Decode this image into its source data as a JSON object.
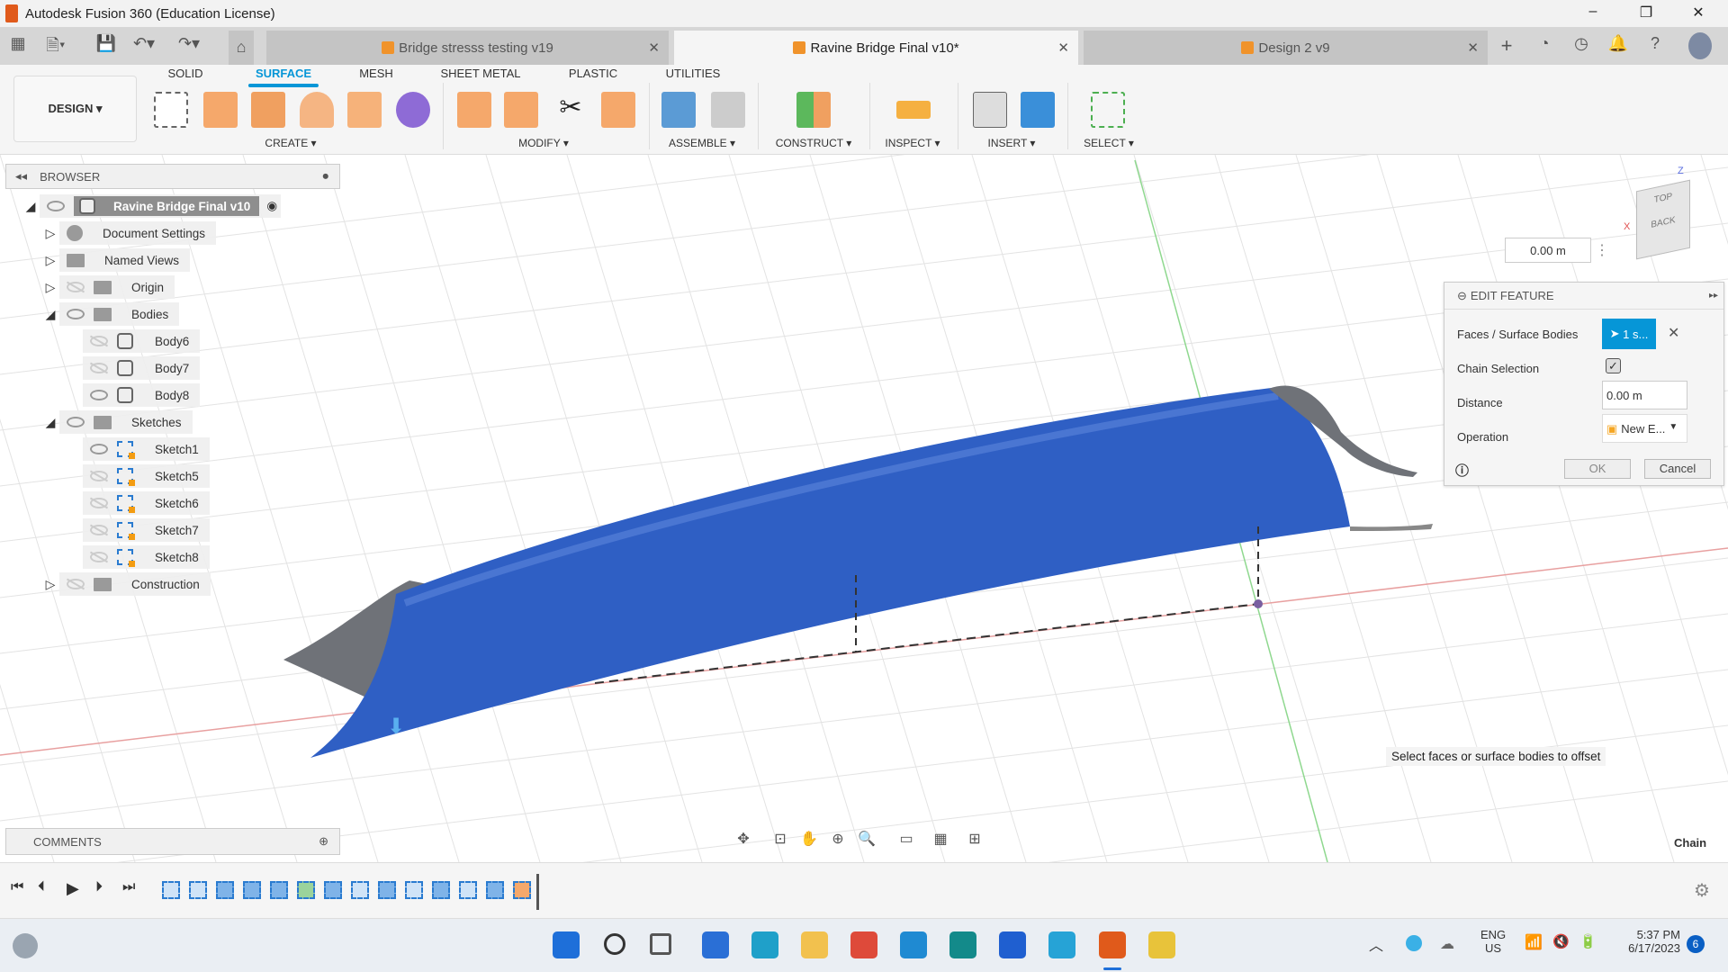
{
  "app": {
    "title": "Autodesk Fusion 360 (Education License)"
  },
  "doc_tabs": [
    {
      "label": "Bridge stresss testing v19"
    },
    {
      "label": "Ravine Bridge Final v10*"
    },
    {
      "label": "Design 2 v9"
    }
  ],
  "workspace": {
    "design_label": "DESIGN ▾",
    "tabs": [
      "SOLID",
      "SURFACE",
      "MESH",
      "SHEET METAL",
      "PLASTIC",
      "UTILITIES"
    ],
    "active_tab": "SURFACE",
    "groups": [
      "CREATE ▾",
      "MODIFY ▾",
      "ASSEMBLE ▾",
      "CONSTRUCT ▾",
      "INSPECT ▾",
      "INSERT ▾",
      "SELECT ▾"
    ]
  },
  "browser": {
    "title": "BROWSER",
    "root": "Ravine Bridge Final v10",
    "items": [
      {
        "label": "Document Settings",
        "level": 1,
        "icon": "gear-icon"
      },
      {
        "label": "Named Views",
        "level": 1,
        "icon": "folder-icon"
      },
      {
        "label": "Origin",
        "level": 1,
        "icon": "folder-icon",
        "visible": false
      },
      {
        "label": "Bodies",
        "level": 1,
        "icon": "folder-icon",
        "visible": true,
        "expanded": true
      },
      {
        "label": "Body6",
        "level": 2,
        "icon": "body-icon",
        "visible": false
      },
      {
        "label": "Body7",
        "level": 2,
        "icon": "body-icon",
        "visible": false
      },
      {
        "label": "Body8",
        "level": 2,
        "icon": "body-icon",
        "visible": true
      },
      {
        "label": "Sketches",
        "level": 1,
        "icon": "folder-icon",
        "visible": true,
        "expanded": true
      },
      {
        "label": "Sketch1",
        "level": 2,
        "icon": "sketch-icon",
        "visible": true
      },
      {
        "label": "Sketch5",
        "level": 2,
        "icon": "sketch-icon",
        "visible": false
      },
      {
        "label": "Sketch6",
        "level": 2,
        "icon": "sketch-icon",
        "visible": false
      },
      {
        "label": "Sketch7",
        "level": 2,
        "icon": "sketch-icon",
        "visible": false
      },
      {
        "label": "Sketch8",
        "level": 2,
        "icon": "sketch-icon",
        "visible": false
      },
      {
        "label": "Construction",
        "level": 1,
        "icon": "folder-icon",
        "visible": false
      }
    ]
  },
  "comments": {
    "title": "COMMENTS"
  },
  "viewport": {
    "distance_input": "0.00 m",
    "viewcube": {
      "top": "TOP",
      "back": "BACK",
      "x": "X",
      "z": "Z"
    },
    "tooltip": "Select faces or surface bodies to offset",
    "selection_filter": "Chain"
  },
  "edit_feature": {
    "title": "EDIT FEATURE",
    "faces_label": "Faces / Surface Bodies",
    "faces_value": "1 s...",
    "chain_label": "Chain Selection",
    "chain_checked": true,
    "distance_label": "Distance",
    "distance_value": "0.00 m",
    "operation_label": "Operation",
    "operation_value": "New E...",
    "ok": "OK",
    "cancel": "Cancel"
  },
  "taskbar": {
    "lang1": "ENG",
    "lang2": "US",
    "time": "5:37 PM",
    "date": "6/17/2023",
    "notifications": "6"
  },
  "colors": {
    "accent": "#0696d7",
    "bridge": "#2f5fc4"
  }
}
